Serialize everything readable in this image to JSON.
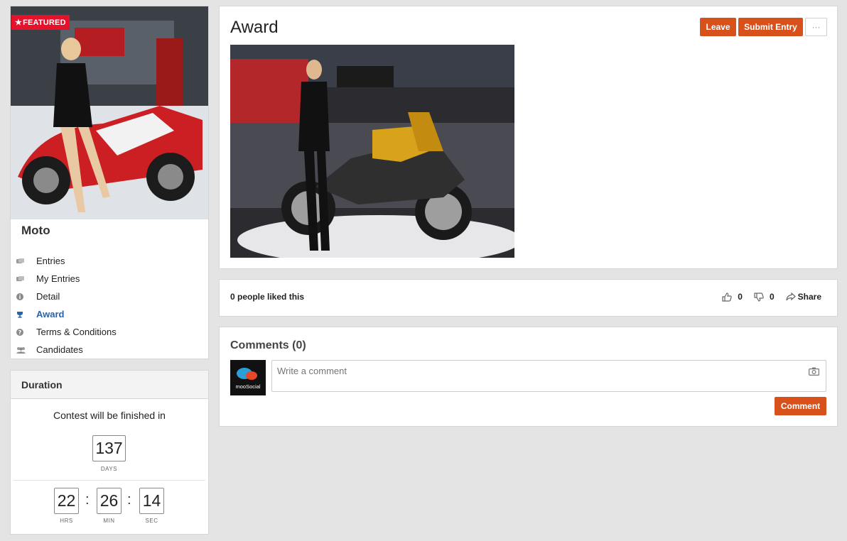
{
  "contest": {
    "badge": "FEATURED",
    "title": "Moto",
    "menu": [
      {
        "label": "Entries",
        "icon": "entries-icon"
      },
      {
        "label": "My Entries",
        "icon": "my-entries-icon"
      },
      {
        "label": "Detail",
        "icon": "info-icon"
      },
      {
        "label": "Award",
        "icon": "trophy-icon",
        "active": true
      },
      {
        "label": "Terms & Conditions",
        "icon": "question-icon"
      },
      {
        "label": "Candidates",
        "icon": "users-icon"
      }
    ]
  },
  "duration": {
    "header": "Duration",
    "text": "Contest will be finished in",
    "days": "137",
    "days_label": "DAYS",
    "hours": "22",
    "hours_label": "HRS",
    "minutes": "26",
    "minutes_label": "MIN",
    "seconds": "14",
    "seconds_label": "SEC"
  },
  "award": {
    "title": "Award",
    "leave_label": "Leave",
    "submit_label": "Submit Entry",
    "more_label": "···"
  },
  "likes": {
    "summary": "0 people liked this",
    "like_count": "0",
    "dislike_count": "0",
    "share_label": "Share"
  },
  "comments": {
    "title": "Comments (0)",
    "placeholder": "Write a comment",
    "submit_label": "Comment",
    "avatar_text": "mooSocial"
  },
  "colors": {
    "accent": "#d8501a",
    "featured": "#e4122b",
    "active_link": "#2a62a8"
  }
}
